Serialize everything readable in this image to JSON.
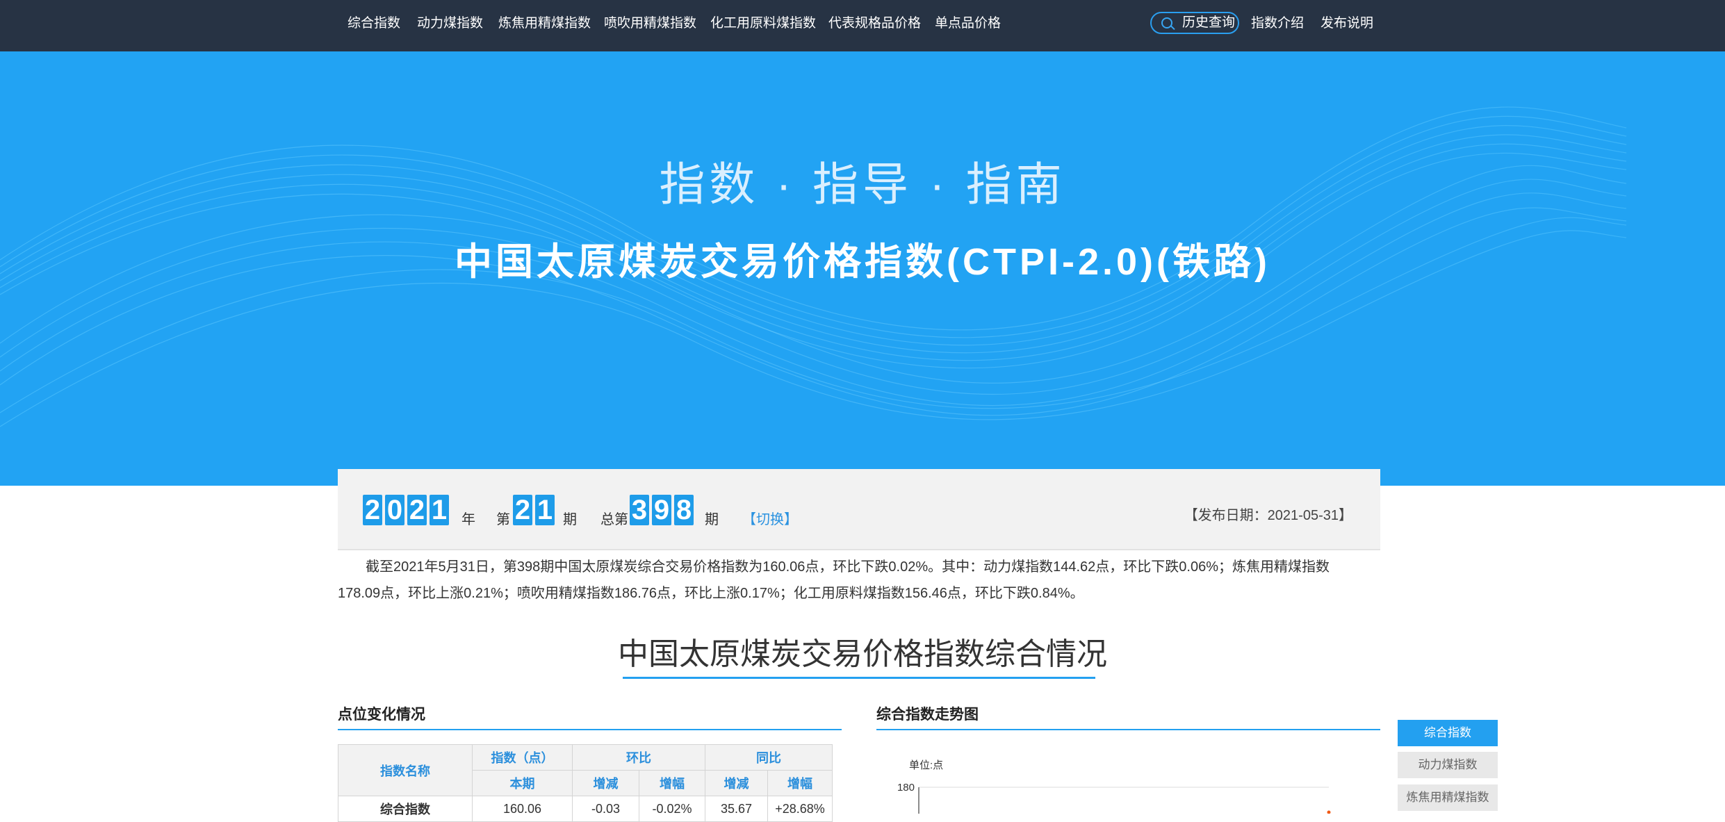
{
  "nav": {
    "items": [
      "综合指数",
      "动力煤指数",
      "炼焦用精煤指数",
      "喷吹用精煤指数",
      "化工用原料煤指数",
      "代表规格品价格",
      "单点品价格"
    ],
    "history_search": "历史查询",
    "intro": "指数介绍",
    "release_note": "发布说明"
  },
  "banner": {
    "slogan": "指数 · 指导 · 指南",
    "title": "中国太原煤炭交易价格指数(CTPI-2.0)(铁路)"
  },
  "period": {
    "year": "2021",
    "year_unit": "年",
    "issue_prefix": "第",
    "issue": "21",
    "issue_unit": "期",
    "total_prefix": "总第",
    "total": "398",
    "total_unit": "期",
    "switch": "【切换】",
    "publish_date": "【发布日期：2021-05-31】"
  },
  "summary": "截至2021年5月31日，第398期中国太原煤炭综合交易价格指数为160.06点，环比下跌0.02%。其中：动力煤指数144.62点，环比下跌0.06%；炼焦用精煤指数178.09点，环比上涨0.21%；喷吹用精煤指数186.76点，环比上涨0.17%；化工用原料煤指数156.46点，环比下跌0.84%。",
  "section_title": "中国太原煤炭交易价格指数综合情况",
  "points_panel": {
    "title": "点位变化情况",
    "headers": {
      "name": "指数名称",
      "index": "指数（点）",
      "mom": "环比",
      "yoy": "同比",
      "current": "本期",
      "change": "增减",
      "rate": "增幅",
      "change2": "增减",
      "rate2": "增幅"
    },
    "rows": [
      {
        "name": "综合指数",
        "current": "160.06",
        "mom_change": "-0.03",
        "mom_rate": "-0.02%",
        "yoy_change": "35.67",
        "yoy_rate": "+28.68%"
      }
    ]
  },
  "trend_panel": {
    "title": "综合指数走势图",
    "chart_data": {
      "type": "line",
      "ylabel": "单位:点",
      "y_ticks": [
        "180"
      ],
      "series": []
    }
  },
  "side_tabs": [
    "综合指数",
    "动力煤指数",
    "炼焦用精煤指数"
  ],
  "colors": {
    "nav_bg": "#273344",
    "banner_bg": "#22a3f3",
    "accent": "#23a0f0",
    "down": "#1aa637",
    "up": "#f05a16"
  }
}
